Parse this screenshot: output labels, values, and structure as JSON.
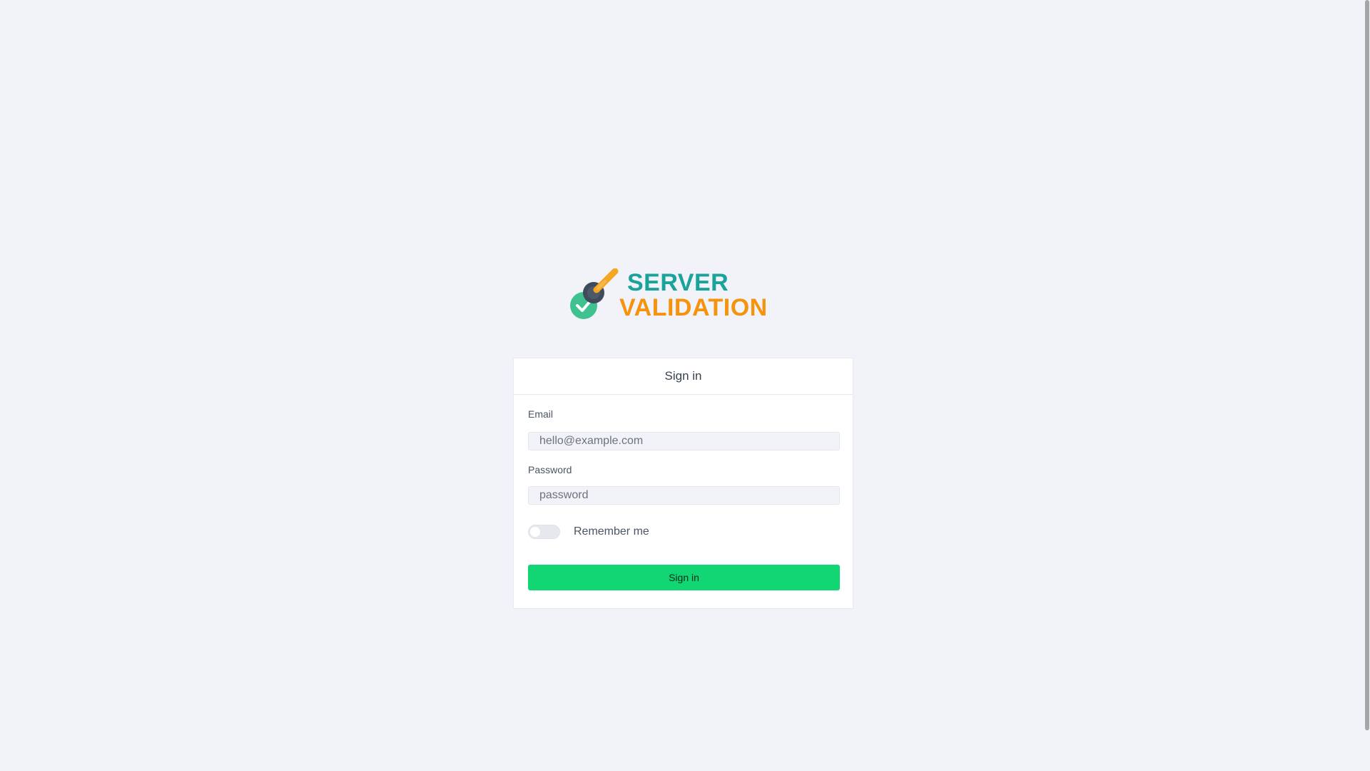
{
  "logo": {
    "line1": "SERVER",
    "line2": "VALIDATION",
    "icon": "validation-brush-check-icon",
    "colors": {
      "teal": "#1aa39a",
      "orange": "#f5930f",
      "green": "#3ec28f",
      "dark": "#3f4a5a"
    }
  },
  "card": {
    "title": "Sign in",
    "email": {
      "label": "Email",
      "placeholder": "hello@example.com"
    },
    "password": {
      "label": "Password",
      "placeholder": "password"
    },
    "remember": {
      "label": "Remember me",
      "checked": false
    },
    "submit_label": "Sign in"
  },
  "colors": {
    "background": "#f1f3f8",
    "button": "#12d673"
  }
}
